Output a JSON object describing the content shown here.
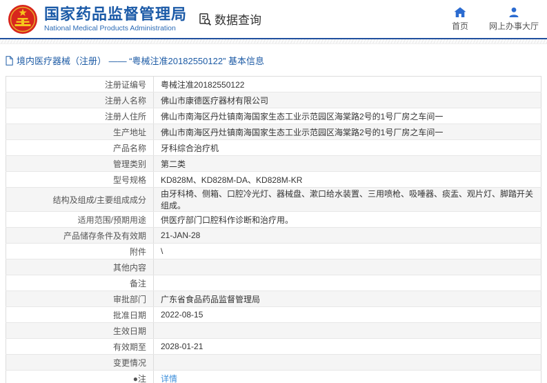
{
  "header": {
    "title": "国家药品监督管理局",
    "subtitle": "National Medical Products Administration",
    "section": "数据查询",
    "nav_home": "首页",
    "nav_hall": "网上办事大厅"
  },
  "breadcrumb": "境内医疗器械（注册） —— “粤械注准20182550122” 基本信息",
  "table": {
    "rows": [
      {
        "label": "注册证编号",
        "value": "粤械注准20182550122"
      },
      {
        "label": "注册人名称",
        "value": "佛山市康德医疗器材有限公司"
      },
      {
        "label": "注册人住所",
        "value": "佛山市南海区丹灶镇南海国家生态工业示范园区海棠路2号的1号厂房之车间一"
      },
      {
        "label": "生产地址",
        "value": "佛山市南海区丹灶镇南海国家生态工业示范园区海棠路2号的1号厂房之车间一"
      },
      {
        "label": "产品名称",
        "value": "牙科综合治疗机"
      },
      {
        "label": "管理类别",
        "value": "第二类"
      },
      {
        "label": "型号规格",
        "value": "KD828M、KD828M-DA、KD828M-KR"
      },
      {
        "label": "结构及组成/主要组成成分",
        "value": "由牙科椅、侧箱、口腔冷光灯、器械盘、漱口给水装置、三用喷枪、吸唾器、痰盂、观片灯、脚踏开关组成。"
      },
      {
        "label": "适用范围/预期用途",
        "value": "供医疗部门口腔科作诊断和治疗用。"
      },
      {
        "label": "产品储存条件及有效期",
        "value": "21-JAN-28"
      },
      {
        "label": "附件",
        "value": "\\"
      },
      {
        "label": "其他内容",
        "value": ""
      },
      {
        "label": "备注",
        "value": ""
      },
      {
        "label": "审批部门",
        "value": "广东省食品药品监督管理局"
      },
      {
        "label": "批准日期",
        "value": "2022-08-15"
      },
      {
        "label": "生效日期",
        "value": ""
      },
      {
        "label": "有效期至",
        "value": "2028-01-21"
      },
      {
        "label": "变更情况",
        "value": ""
      },
      {
        "label": "●注",
        "value": "详情"
      }
    ]
  },
  "colors": {
    "brand_blue": "#1b5aa7",
    "accent_blue": "#2b6bd0",
    "link_blue": "#3d8fdb",
    "header_rule": "#1f4f9e",
    "row_alt": "#f5f5f5",
    "border": "#dcdcdc"
  }
}
